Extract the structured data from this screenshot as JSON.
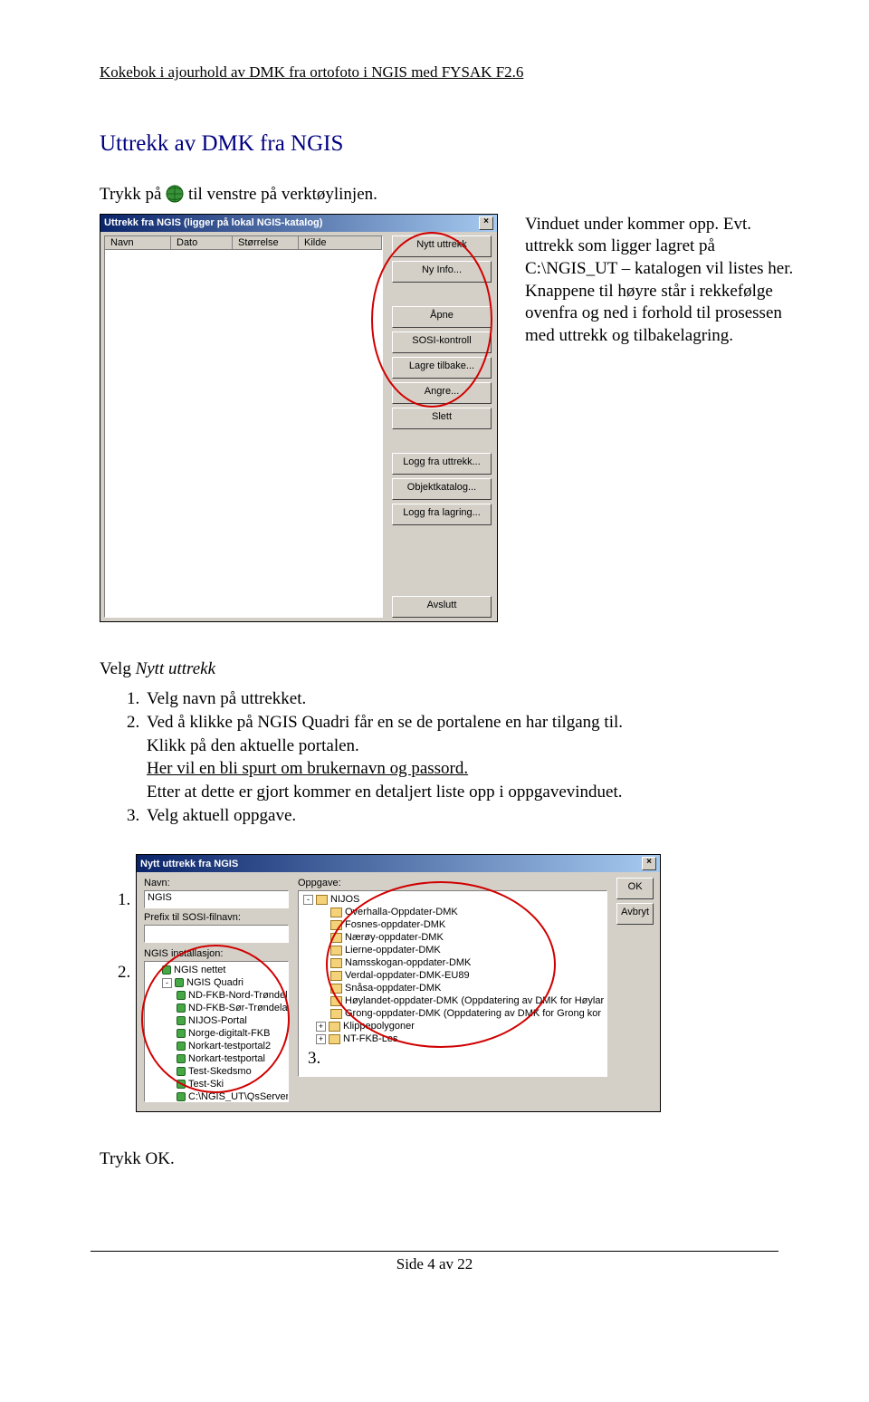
{
  "header": "Kokebok i ajourhold av DMK fra ortofoto i NGIS med FYSAK F2.6",
  "section_title": "Uttrekk av DMK fra NGIS",
  "intro1a": "Trykk på ",
  "intro1b": " til venstre på verktøylinjen.",
  "right_para": "Vinduet under kommer opp. Evt. uttrekk som ligger lagret på C:\\NGIS_UT – katalogen vil listes her. Knappene til høyre står i rekkefølge ovenfra og ned i forhold til prosessen med uttrekk og tilbakelagring.",
  "win1": {
    "title": "Uttrekk fra NGIS (ligger på lokal NGIS-katalog)",
    "cols": [
      "Navn",
      "Dato",
      "Størrelse",
      "Kilde"
    ],
    "buttons": [
      "Nytt uttrekk",
      "Ny Info...",
      "Åpne",
      "SOSI-kontroll",
      "Lagre tilbake...",
      "Angre...",
      "Slett"
    ],
    "buttons2": [
      "Logg fra uttrekk...",
      "Objektkatalog...",
      "Logg fra lagring..."
    ],
    "buttons3": [
      "Avslutt"
    ]
  },
  "mid_heading_a": "Velg ",
  "mid_heading_b": "Nytt uttrekk",
  "steps": {
    "s1": "Velg navn på uttrekket.",
    "s2a": "Ved å klikke på NGIS Quadri  får en se de portalene en har tilgang til.",
    "s2b": "Klikk på den aktuelle portalen.",
    "s2c": "Her vil en bli spurt om brukernavn og passord.",
    "s2d": "Etter at dette er gjort kommer en detaljert liste opp i oppgavevinduet.",
    "s3": "Velg aktuell oppgave."
  },
  "win2": {
    "title": "Nytt uttrekk fra NGIS",
    "navn_label": "Navn:",
    "navn_value": "NGIS",
    "prefix_label": "Prefix til SOSI-filnavn:",
    "inst_label": "NGIS installasjon:",
    "opp_label": "Oppgave:",
    "ok": "OK",
    "cancel": "Avbryt",
    "left_tree": [
      {
        "t": "NGIS nettet",
        "cls": "gn",
        "ind": "ind1",
        "pm": ""
      },
      {
        "t": "NGIS Quadri",
        "cls": "gn",
        "ind": "ind1",
        "pm": "-"
      },
      {
        "t": "ND-FKB-Nord-Trøndelag",
        "cls": "gn",
        "ind": "ind2",
        "pm": ""
      },
      {
        "t": "ND-FKB-Sør-Trøndelag",
        "cls": "gn",
        "ind": "ind2",
        "pm": ""
      },
      {
        "t": "NIJOS-Portal",
        "cls": "gn",
        "ind": "ind2",
        "pm": ""
      },
      {
        "t": "Norge-digitalt-FKB",
        "cls": "gn",
        "ind": "ind2",
        "pm": ""
      },
      {
        "t": "Norkart-testportal2",
        "cls": "gn",
        "ind": "ind2",
        "pm": ""
      },
      {
        "t": "Norkart-testportal",
        "cls": "gn",
        "ind": "ind2",
        "pm": ""
      },
      {
        "t": "Test-Skedsmo",
        "cls": "gn",
        "ind": "ind2",
        "pm": ""
      },
      {
        "t": "Test-Ski",
        "cls": "gn",
        "ind": "ind2",
        "pm": ""
      },
      {
        "t": "C:\\NGIS_UT\\QsServerLis",
        "cls": "gn",
        "ind": "ind2",
        "pm": ""
      }
    ],
    "right_tree_root": "NIJOS",
    "right_tree": [
      "Overhalla-Oppdater-DMK",
      "Fosnes-oppdater-DMK",
      "Nærøy-oppdater-DMK",
      "Lierne-oppdater-DMK",
      "Namsskogan-oppdater-DMK",
      "Verdal-oppdater-DMK-EU89",
      "Snåsa-oppdater-DMK",
      "Høylandet-oppdater-DMK  (Oppdatering av DMK for Høylar",
      "Grong-oppdater-DMK  (Oppdatering av DMK for Grong kor"
    ],
    "right_tree_extra1": "Klippepolygoner",
    "right_tree_extra2": "NT-FKB-Les"
  },
  "markers": {
    "m1": "1.",
    "m2": "2.",
    "m3": "3."
  },
  "trykk_ok": "Trykk OK.",
  "footer": "Side 4 av 22"
}
